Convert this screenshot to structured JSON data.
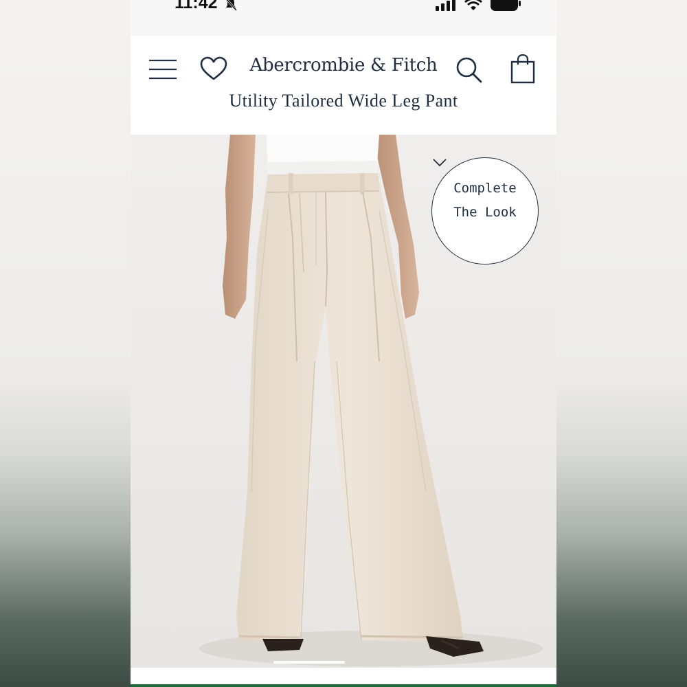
{
  "status_bar": {
    "time": "11:42",
    "icons": [
      "bell-off-icon",
      "signal-icon",
      "wifi-icon",
      "battery-icon"
    ]
  },
  "header": {
    "brand": "Abercrombie & Fitch",
    "icons": [
      "menu-icon",
      "heart-icon",
      "search-icon",
      "bag-icon"
    ]
  },
  "product": {
    "title": "Utility Tailored Wide Leg Pant"
  },
  "complete_look": {
    "label": "Complete\nThe Look",
    "icon": "chevron-down-icon"
  },
  "colors": {
    "brand_navy": "#1f2d40",
    "pant_cream": "#e9ded0",
    "image_background": "#eeecea"
  }
}
